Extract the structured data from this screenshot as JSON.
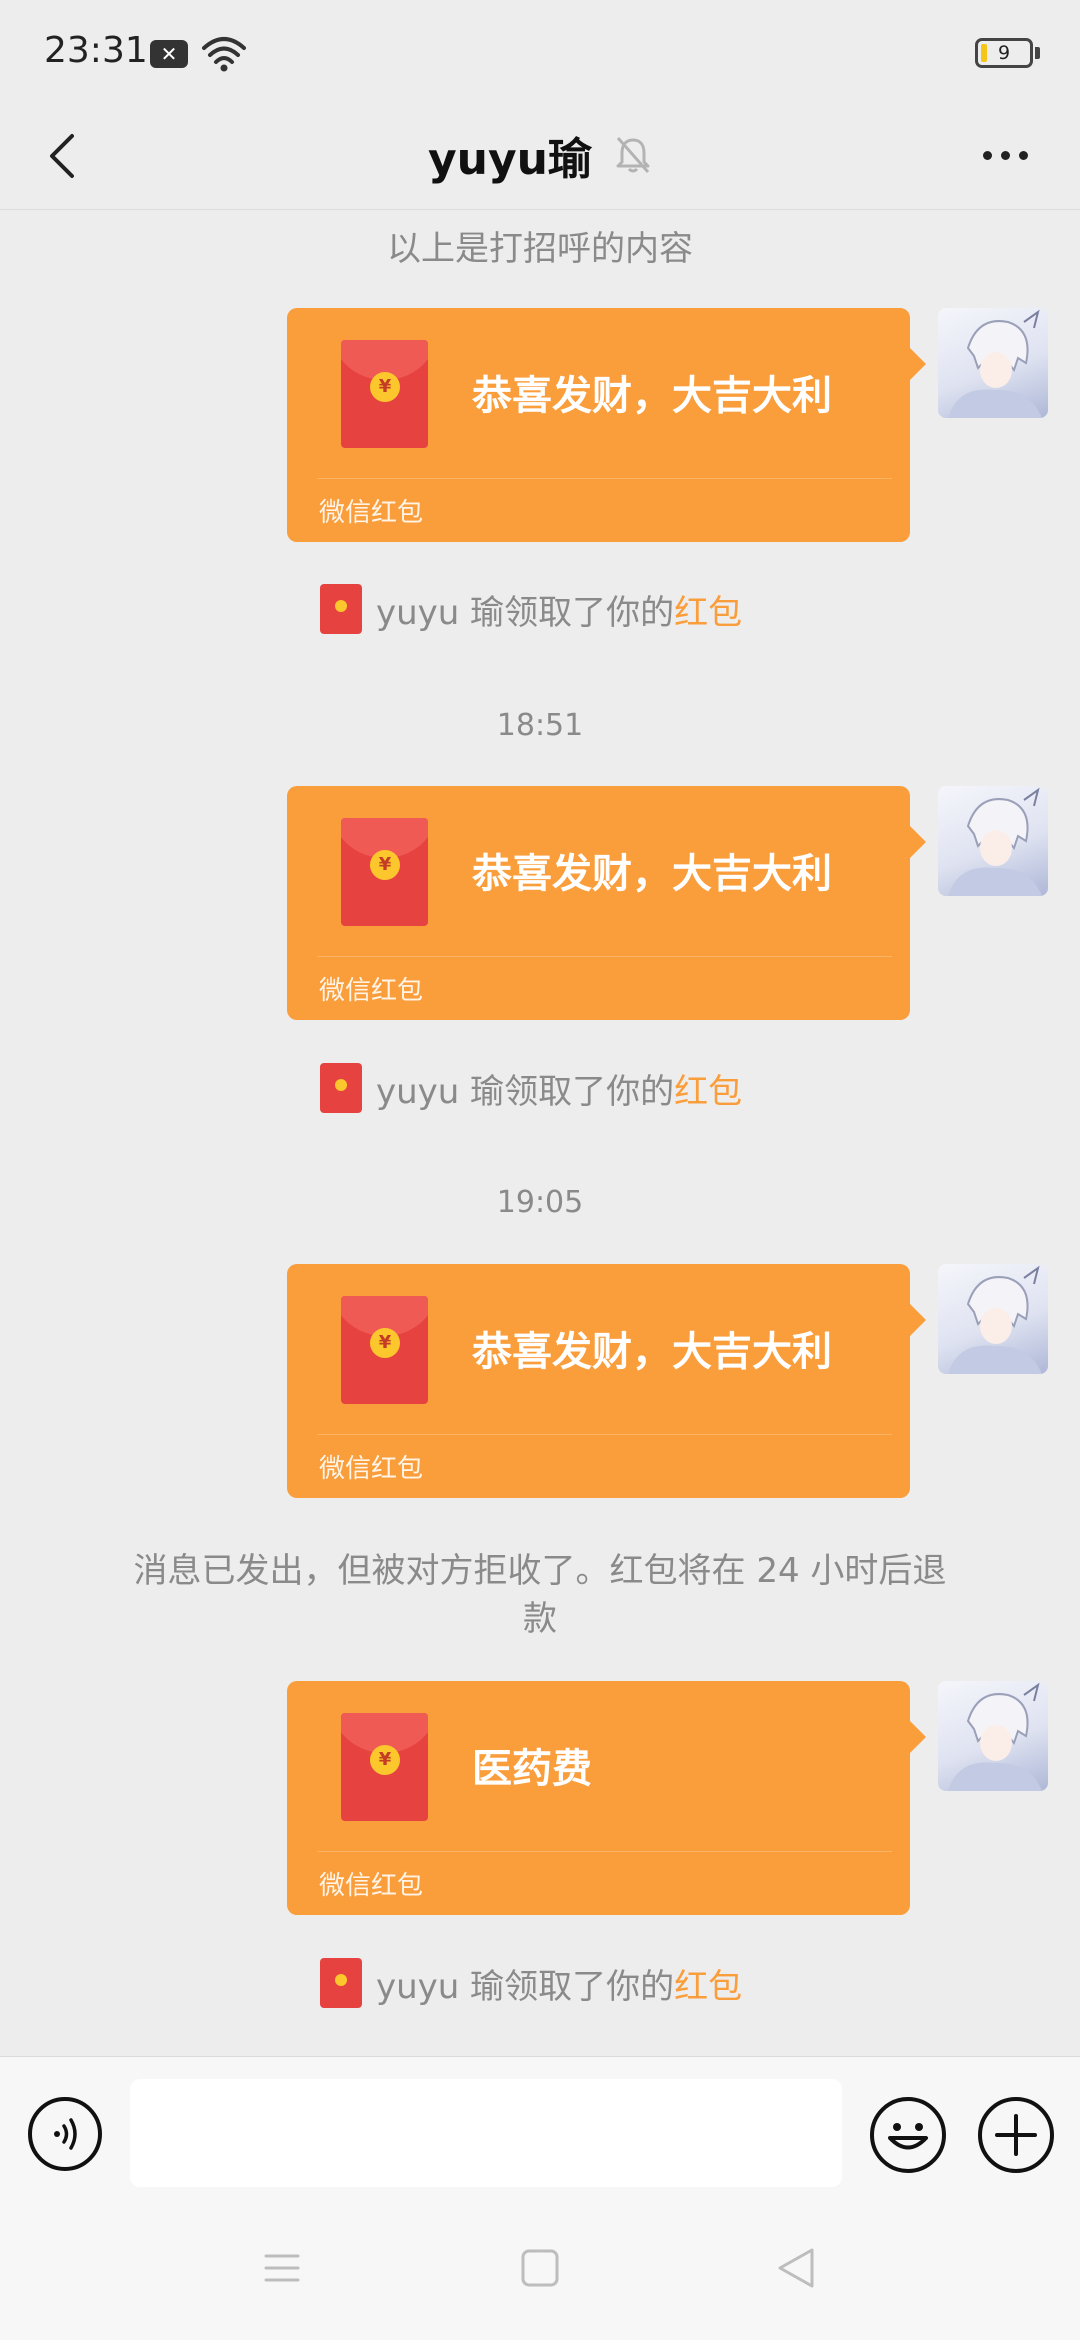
{
  "status_bar": {
    "time": "23:31",
    "battery": "9"
  },
  "header": {
    "title": "yuyu瑜",
    "icons": [
      "back-arrow-icon",
      "mute-bell-icon",
      "more-dots-icon"
    ]
  },
  "messages": {
    "greeting_note": "以上是打招呼的内容",
    "packet_1": {
      "text": "恭喜发财，大吉大利",
      "label": "微信红包"
    },
    "received_1": {
      "prefix": "yuyu 瑜领取了你的",
      "link": "红包"
    },
    "time_1": "18:51",
    "packet_2": {
      "text": "恭喜发财，大吉大利",
      "label": "微信红包"
    },
    "received_2": {
      "prefix": "yuyu 瑜领取了你的",
      "link": "红包"
    },
    "time_2": "19:05",
    "packet_3": {
      "text": "恭喜发财，大吉大利",
      "label": "微信红包"
    },
    "rejected_line1": "消息已发出，但被对方拒收了。红包将在 24 小时后退",
    "rejected_line2": "款",
    "packet_4": {
      "text": "医药费",
      "label": "微信红包"
    },
    "received_3": {
      "prefix": "yuyu 瑜领取了你的",
      "link": "红包"
    }
  },
  "input_bar": {
    "placeholder": "",
    "icons": [
      "voice-icon",
      "emoji-icon",
      "plus-icon"
    ]
  },
  "colors": {
    "background": "#ededed",
    "packet_orange": "#fa9d3b",
    "packet_red": "#e64340",
    "coin_gold": "#fcc72c",
    "system_text": "#8a8a8a"
  }
}
